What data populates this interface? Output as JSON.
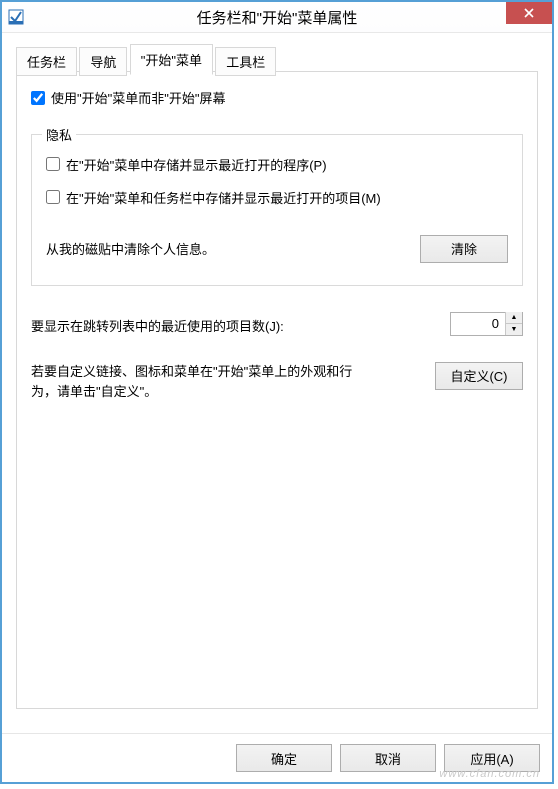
{
  "window": {
    "title": "任务栏和\"开始\"菜单属性"
  },
  "tabs": {
    "items": [
      {
        "label": "任务栏"
      },
      {
        "label": "导航"
      },
      {
        "label": "\"开始\"菜单"
      },
      {
        "label": "工具栏"
      }
    ],
    "active_index": 2
  },
  "use_start_menu_checkbox": {
    "label": "使用\"开始\"菜单而非\"开始\"屏幕",
    "checked": true
  },
  "privacy": {
    "legend": "隐私",
    "store_programs": {
      "label": "在\"开始\"菜单中存储并显示最近打开的程序(P)",
      "checked": false
    },
    "store_items": {
      "label": "在\"开始\"菜单和任务栏中存储并显示最近打开的项目(M)",
      "checked": false
    },
    "clear_text": "从我的磁贴中清除个人信息。",
    "clear_button": "清除"
  },
  "jump_list": {
    "label": "要显示在跳转列表中的最近使用的项目数(J):",
    "value": "0"
  },
  "customize": {
    "text": "若要自定义链接、图标和菜单在\"开始\"菜单上的外观和行为，请单击\"自定义\"。",
    "button": "自定义(C)"
  },
  "footer": {
    "ok": "确定",
    "cancel": "取消",
    "apply": "应用(A)"
  },
  "watermark": "www.cfan.com.cn"
}
